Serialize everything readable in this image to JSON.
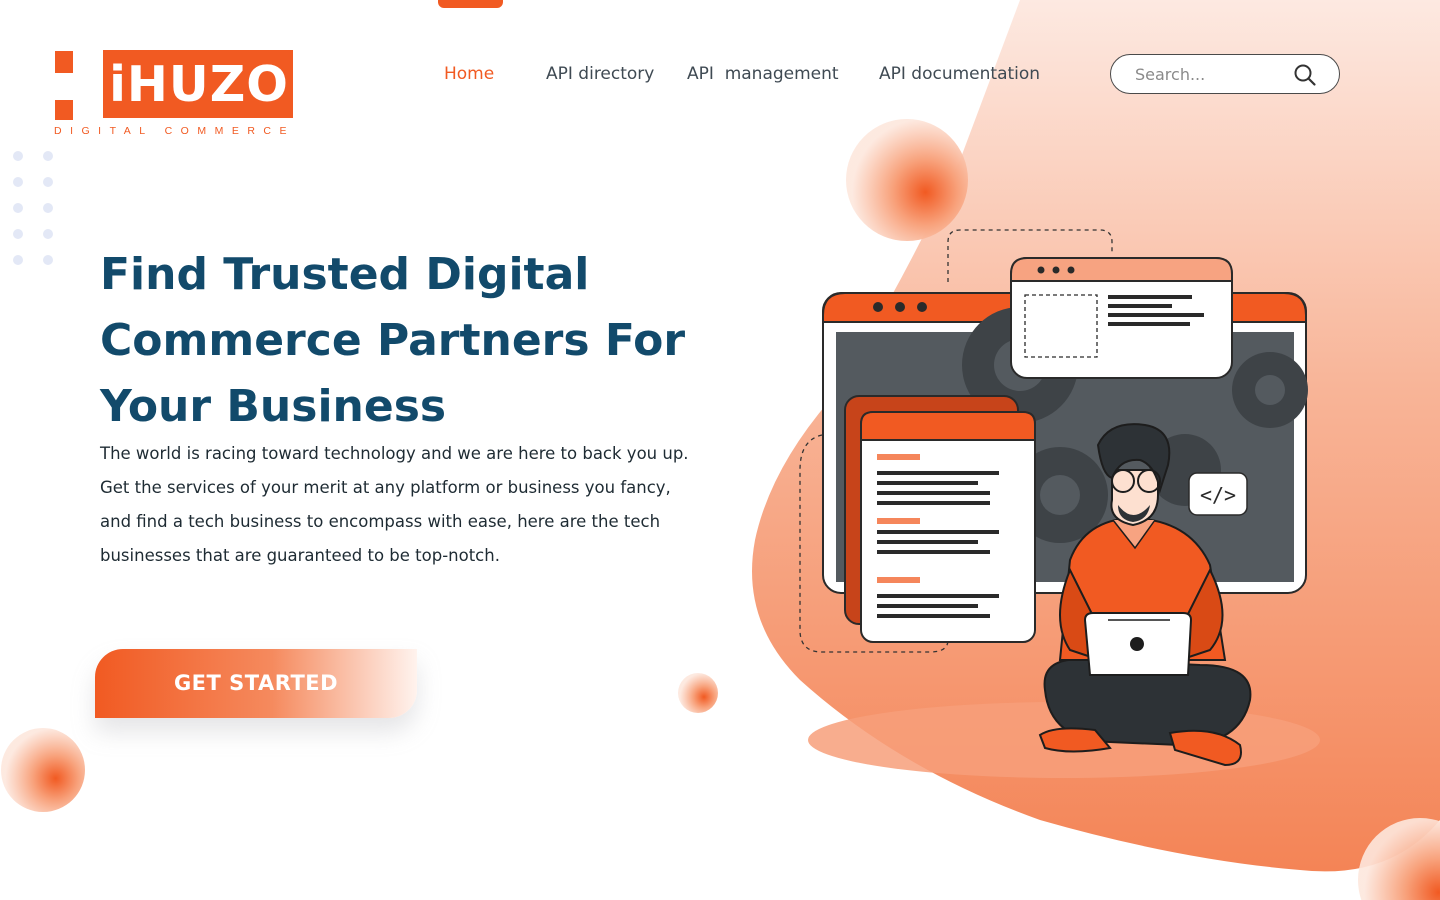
{
  "brand": {
    "name": "iHUZO",
    "tagline": "DIGITAL COMMERCE",
    "accent": "#f15a22",
    "heading_color": "#124a6b"
  },
  "nav": {
    "items": [
      {
        "label": "Home",
        "active": true
      },
      {
        "label": "API directory",
        "active": false
      },
      {
        "label": "API  management",
        "active": false
      },
      {
        "label": "API documentation",
        "active": false
      }
    ]
  },
  "search": {
    "placeholder": "Search...",
    "icon": "search-icon"
  },
  "hero": {
    "title": "Find Trusted Digital Commerce Partners For Your Business",
    "description": "The world is racing toward technology and we are here to back you up. Get the services of your merit at any platform or business you fancy, and find a tech business to encompass with ease, here are the tech businesses that are guaranteed to be top-notch.",
    "cta_label": "GET STARTED"
  },
  "illustration": {
    "code_badge": "</>",
    "icon": "developer-with-laptop-illustration"
  }
}
